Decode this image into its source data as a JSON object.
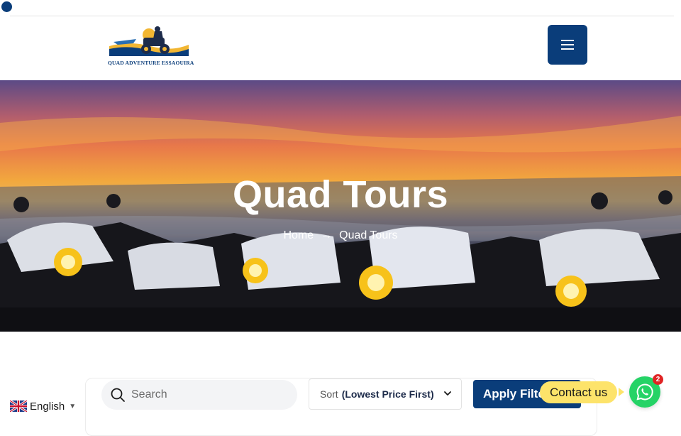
{
  "header": {
    "logo_text": "QUAD ADVENTURE ESSAOUIRA",
    "menu_icon": "hamburger-icon",
    "accent_color": "#0a3d7a"
  },
  "hero": {
    "title": "Quad Tours",
    "breadcrumb": {
      "home": "Home",
      "separator": "→",
      "current": "Quad Tours"
    }
  },
  "filters": {
    "search_placeholder": "Search",
    "sort_label": "Sort",
    "sort_value": "(Lowest Price First)",
    "apply_label": "Apply Filters"
  },
  "contact": {
    "label": "Contact us",
    "badge_count": "2",
    "icon": "whatsapp-icon"
  },
  "language": {
    "label": "English",
    "flag": "uk-flag-icon"
  }
}
